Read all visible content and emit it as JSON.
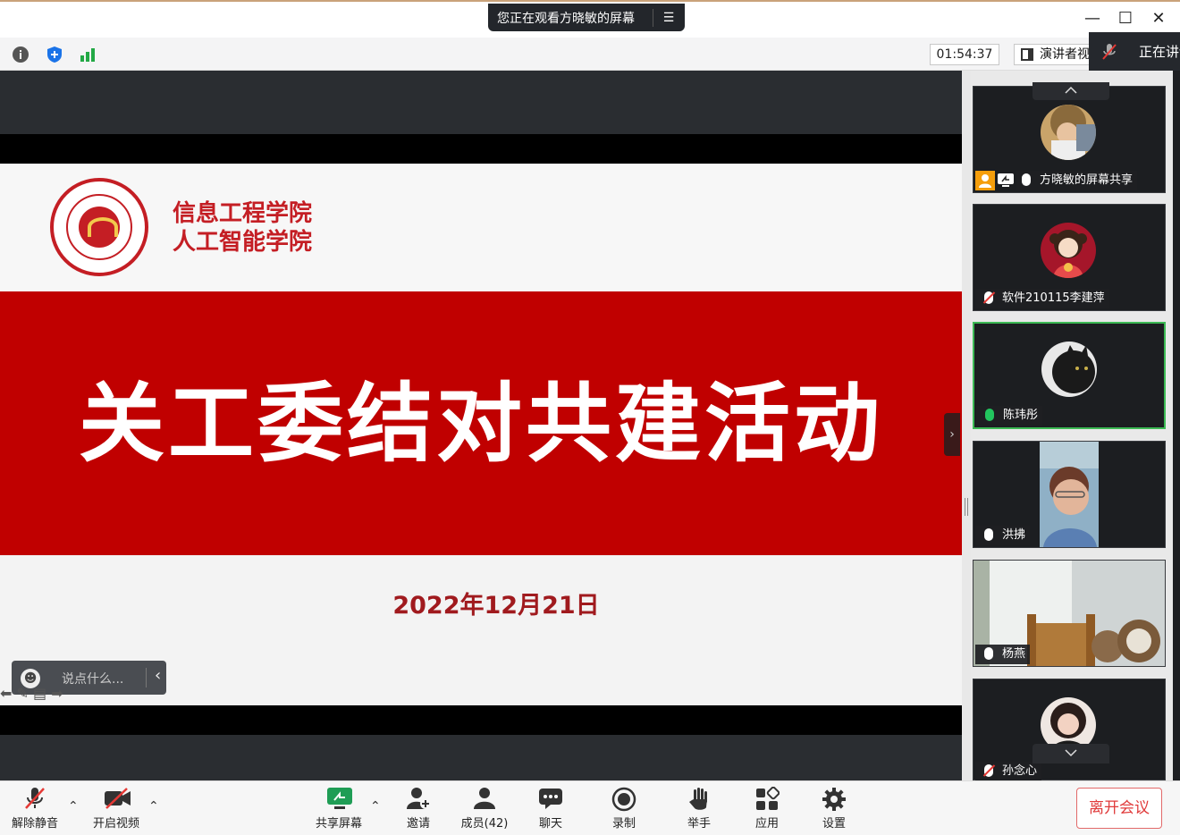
{
  "window": {
    "share_banner": "您正在观看方晓敏的屏幕",
    "menu_glyph": "☰",
    "minimize": "—",
    "maximize": "☐",
    "close": "✕"
  },
  "toolbar_top": {
    "timer": "01:54:37",
    "speaker_view": "演讲者视图",
    "speaking_label": "正在讲话"
  },
  "slide": {
    "school_line1": "信息工程学院",
    "school_line2": "人工智能学院",
    "title": "关工委结对共建活动",
    "date": "2022年12月21日"
  },
  "chat": {
    "placeholder": "说点什么...",
    "emoji": "☻",
    "chevron": "‹"
  },
  "annot_icons": "⬅ ✎ ▤ ➡",
  "participants": [
    {
      "name": "方晓敏的屏幕共享",
      "mic": "on"
    },
    {
      "name": "软件210115李建萍",
      "mic": "muted"
    },
    {
      "name": "陈玮彤",
      "mic": "speaking"
    },
    {
      "name": "洪拂",
      "mic": "on"
    },
    {
      "name": "杨燕",
      "mic": "on"
    },
    {
      "name": "孙念心",
      "mic": "muted"
    }
  ],
  "bottom_toolbar": {
    "unmute": "解除静音",
    "start_video": "开启视频",
    "share_screen": "共享屏幕",
    "invite": "邀请",
    "members": "成员(42)",
    "chat": "聊天",
    "record": "录制",
    "raise_hand": "举手",
    "apps": "应用",
    "settings": "设置",
    "leave": "离开会议"
  },
  "colors": {
    "slide_red": "#c00000",
    "brand_red": "#c41e24",
    "speaking_green": "#3cba54",
    "leave_red": "#e03a3a"
  }
}
